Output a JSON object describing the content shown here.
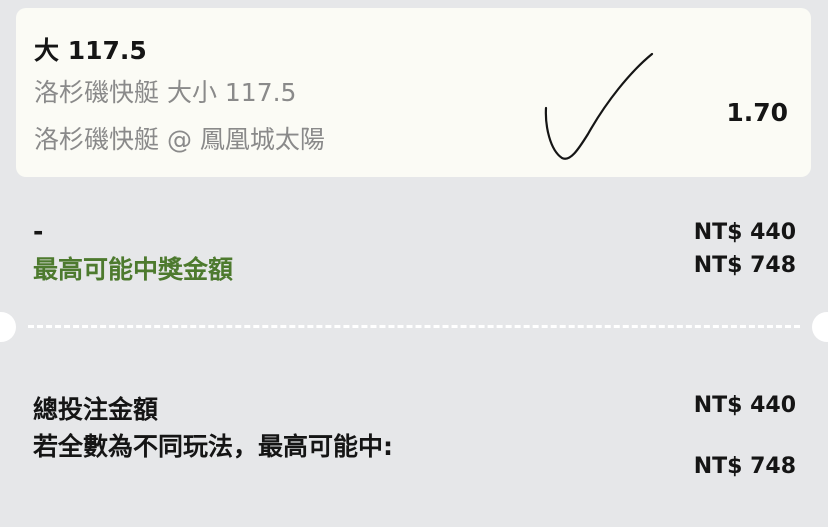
{
  "bet": {
    "selection": "大 117.5",
    "market": "洛杉磯快艇 大小 117.5",
    "event": "洛杉磯快艇 @ 鳳凰城太陽",
    "odds": "1.70"
  },
  "stake_section": {
    "stake_label": "-",
    "stake_amount": "NT$ 440",
    "max_win_label": "最高可能中獎金額",
    "max_win_amount": "NT$ 748",
    "max_win_color": "#4d7a2e"
  },
  "summary": {
    "total_stake_label": "總投注金額",
    "total_stake_amount": "NT$ 440",
    "combo_label": "若全數為不同玩法，最高可能中:",
    "combo_amount": "NT$ 748"
  },
  "icons": {
    "checkmark": "handwritten-checkmark-icon"
  }
}
